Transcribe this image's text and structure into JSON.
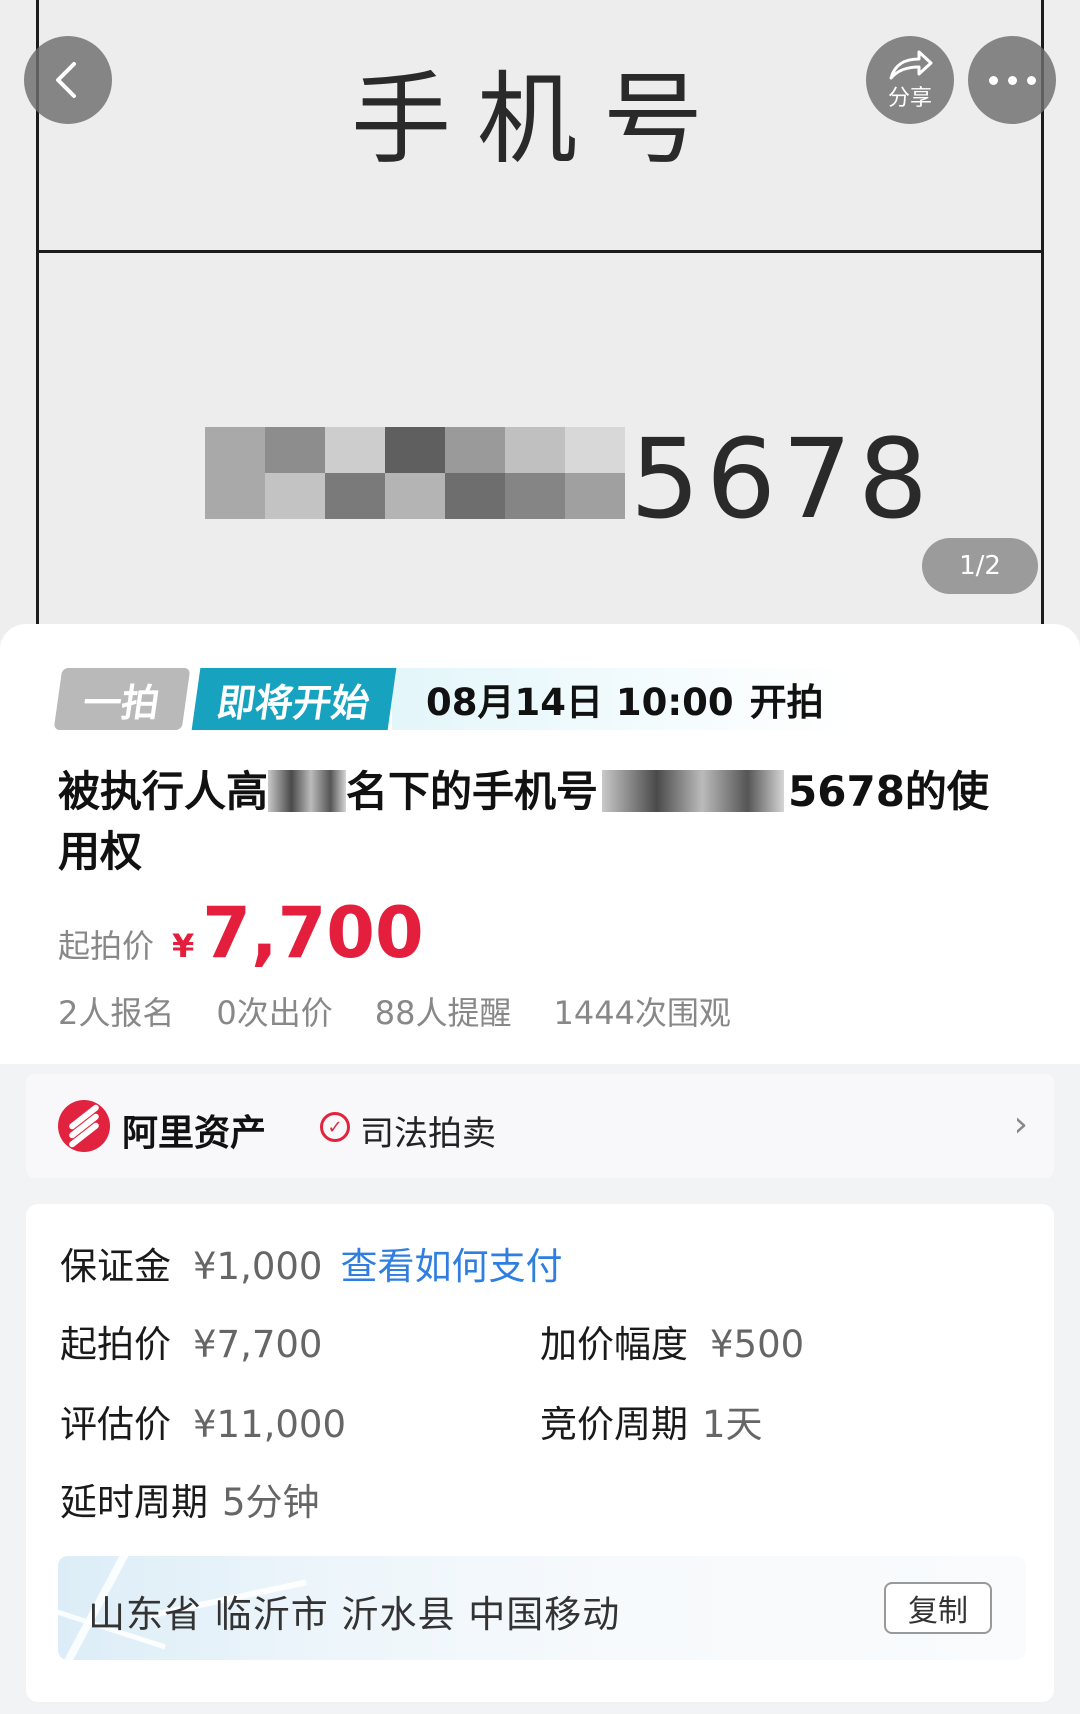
{
  "hero": {
    "doc_header": "手机号",
    "phone_visible_suffix": "5678",
    "page_indicator": "1/2",
    "share_label": "分享",
    "back_icon": "back-arrow-icon",
    "share_icon": "share-icon",
    "more_icon": "more-icon"
  },
  "auction": {
    "tag_type": "一拍",
    "tag_status": "即将开始",
    "start_time": "08月14日 10:00",
    "start_suffix": "开拍",
    "title_part1": "被执行人高",
    "title_part2": "名下的手机号",
    "title_part3": "5678的使用权",
    "start_price_label": "起拍价",
    "currency": "¥",
    "start_price_value": "7,700",
    "accent_color": "#e31f3d",
    "stats": [
      "2人报名",
      "0次出价",
      "88人提醒",
      "1444次围观"
    ]
  },
  "platform": {
    "name": "阿里资产",
    "type": "司法拍卖",
    "brand_color": "#e2233f"
  },
  "details": {
    "deposit_label": "保证金",
    "deposit_value": "¥1,000",
    "deposit_link": "查看如何支付",
    "start_price_label": "起拍价",
    "start_price_value": "¥7,700",
    "increment_label": "加价幅度",
    "increment_value": "¥500",
    "appraisal_label": "评估价",
    "appraisal_value": "¥11,000",
    "bid_period_label": "竞价周期",
    "bid_period_value": "1天",
    "delay_label": "延时周期",
    "delay_value": "5分钟",
    "region": "山东省 临沂市 沂水县 中国移动",
    "copy_label": "复制"
  }
}
